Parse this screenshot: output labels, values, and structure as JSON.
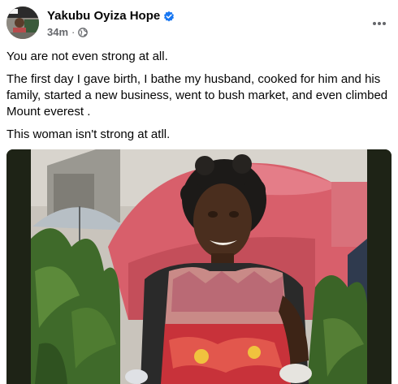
{
  "post": {
    "author": {
      "name": "Yakubu Oyiza Hope",
      "avatar_icon": "profile-photo",
      "verified_icon": "verified-badge-icon"
    },
    "meta": {
      "time": "34m",
      "separator": "·",
      "audience_icon": "globe-icon"
    },
    "more_icon": "more-horizontal-icon",
    "paragraphs": [
      "You are not even strong at all.",
      "The first day I gave birth, I bathe my husband, cooked for him and his family, started a new business, went to bush market, and even climbed Mount everest .",
      "This woman isn't strong at atll."
    ]
  },
  "colors": {
    "text_primary": "#050505",
    "text_secondary": "#65676b",
    "verified_blue": "#1877f2",
    "photo_dark": "#1e2316"
  }
}
